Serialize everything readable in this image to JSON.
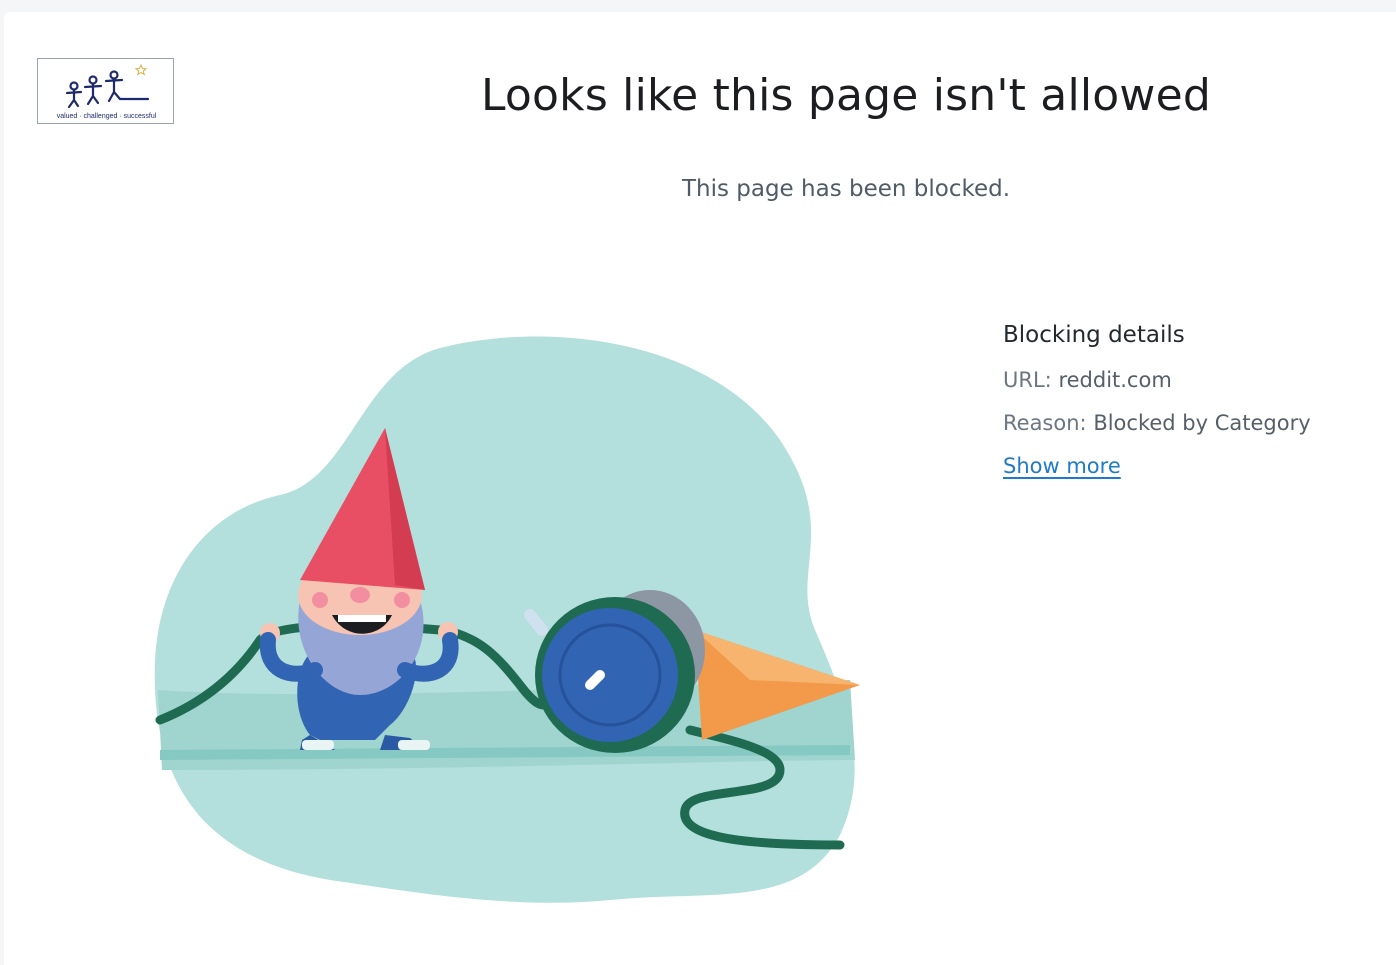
{
  "logo": {
    "caption": "valued · challenged · successful"
  },
  "heading": {
    "title": "Looks like this page isn't allowed",
    "subtitle": "This page has been blocked."
  },
  "details": {
    "heading": "Blocking details",
    "url_label": "URL:",
    "url_value": "reddit.com",
    "reason_label": "Reason:",
    "reason_value": "Blocked by Category",
    "show_more": "Show more"
  },
  "illustration": {
    "icon": "gnome-biting-cable-illustration"
  },
  "colors": {
    "link": "#1f7ac9",
    "blob": "#b3dfdc",
    "hat": "#e94f64",
    "cable": "#1f6b52",
    "plug_blue": "#3264b4",
    "cone": "#f29a4a"
  }
}
